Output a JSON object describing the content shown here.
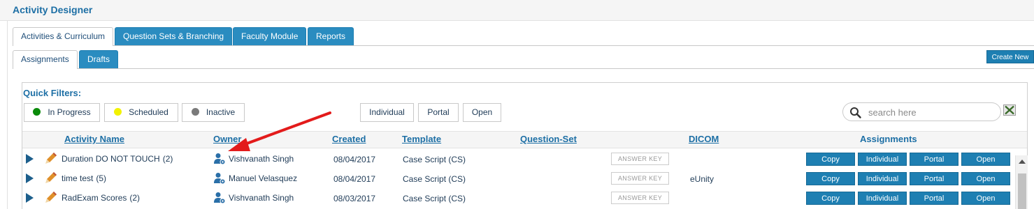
{
  "app": {
    "title": "Activity Designer"
  },
  "tabs": [
    {
      "label": "Activities & Curriculum",
      "active": true
    },
    {
      "label": "Question Sets & Branching",
      "active": false
    },
    {
      "label": "Faculty Module",
      "active": false
    },
    {
      "label": "Reports",
      "active": false
    }
  ],
  "subtabs": [
    {
      "label": "Assignments",
      "active": true
    },
    {
      "label": "Drafts",
      "active": false
    }
  ],
  "actions": {
    "create_new": "Create New"
  },
  "quick_filters": {
    "label": "Quick Filters:",
    "status": [
      {
        "label": "In Progress",
        "color": "#0a8a0a"
      },
      {
        "label": "Scheduled",
        "color": "#f2f200"
      },
      {
        "label": "Inactive",
        "color": "#7a7a7a"
      }
    ],
    "types": [
      "Individual",
      "Portal",
      "Open"
    ]
  },
  "search": {
    "placeholder": "search here",
    "value": ""
  },
  "table": {
    "columns": [
      "Activity Name",
      "Owner",
      "Created",
      "Template",
      "Question-Set",
      "DICOM",
      "Assignments"
    ],
    "answer_key_label": "ANSWER KEY",
    "assignment_buttons": [
      "Copy",
      "Individual",
      "Portal",
      "Open"
    ],
    "rows": [
      {
        "name": "Duration DO NOT TOUCH",
        "count": "(2)",
        "owner": "Vishvanath Singh",
        "created": "08/04/2017",
        "template": "Case Script (CS)",
        "dicom": ""
      },
      {
        "name": "time test",
        "count": "(5)",
        "owner": "Manuel Velasquez",
        "created": "08/04/2017",
        "template": "Case Script (CS)",
        "dicom": "eUnity"
      },
      {
        "name": "RadExam Scores",
        "count": "(2)",
        "owner": "Vishvanath Singh",
        "created": "08/03/2017",
        "template": "Case Script (CS)",
        "dicom": ""
      }
    ]
  },
  "colors": {
    "accent": "#2a8cc0",
    "title": "#1d6fa5",
    "annotation_arrow": "#e31b1b"
  }
}
